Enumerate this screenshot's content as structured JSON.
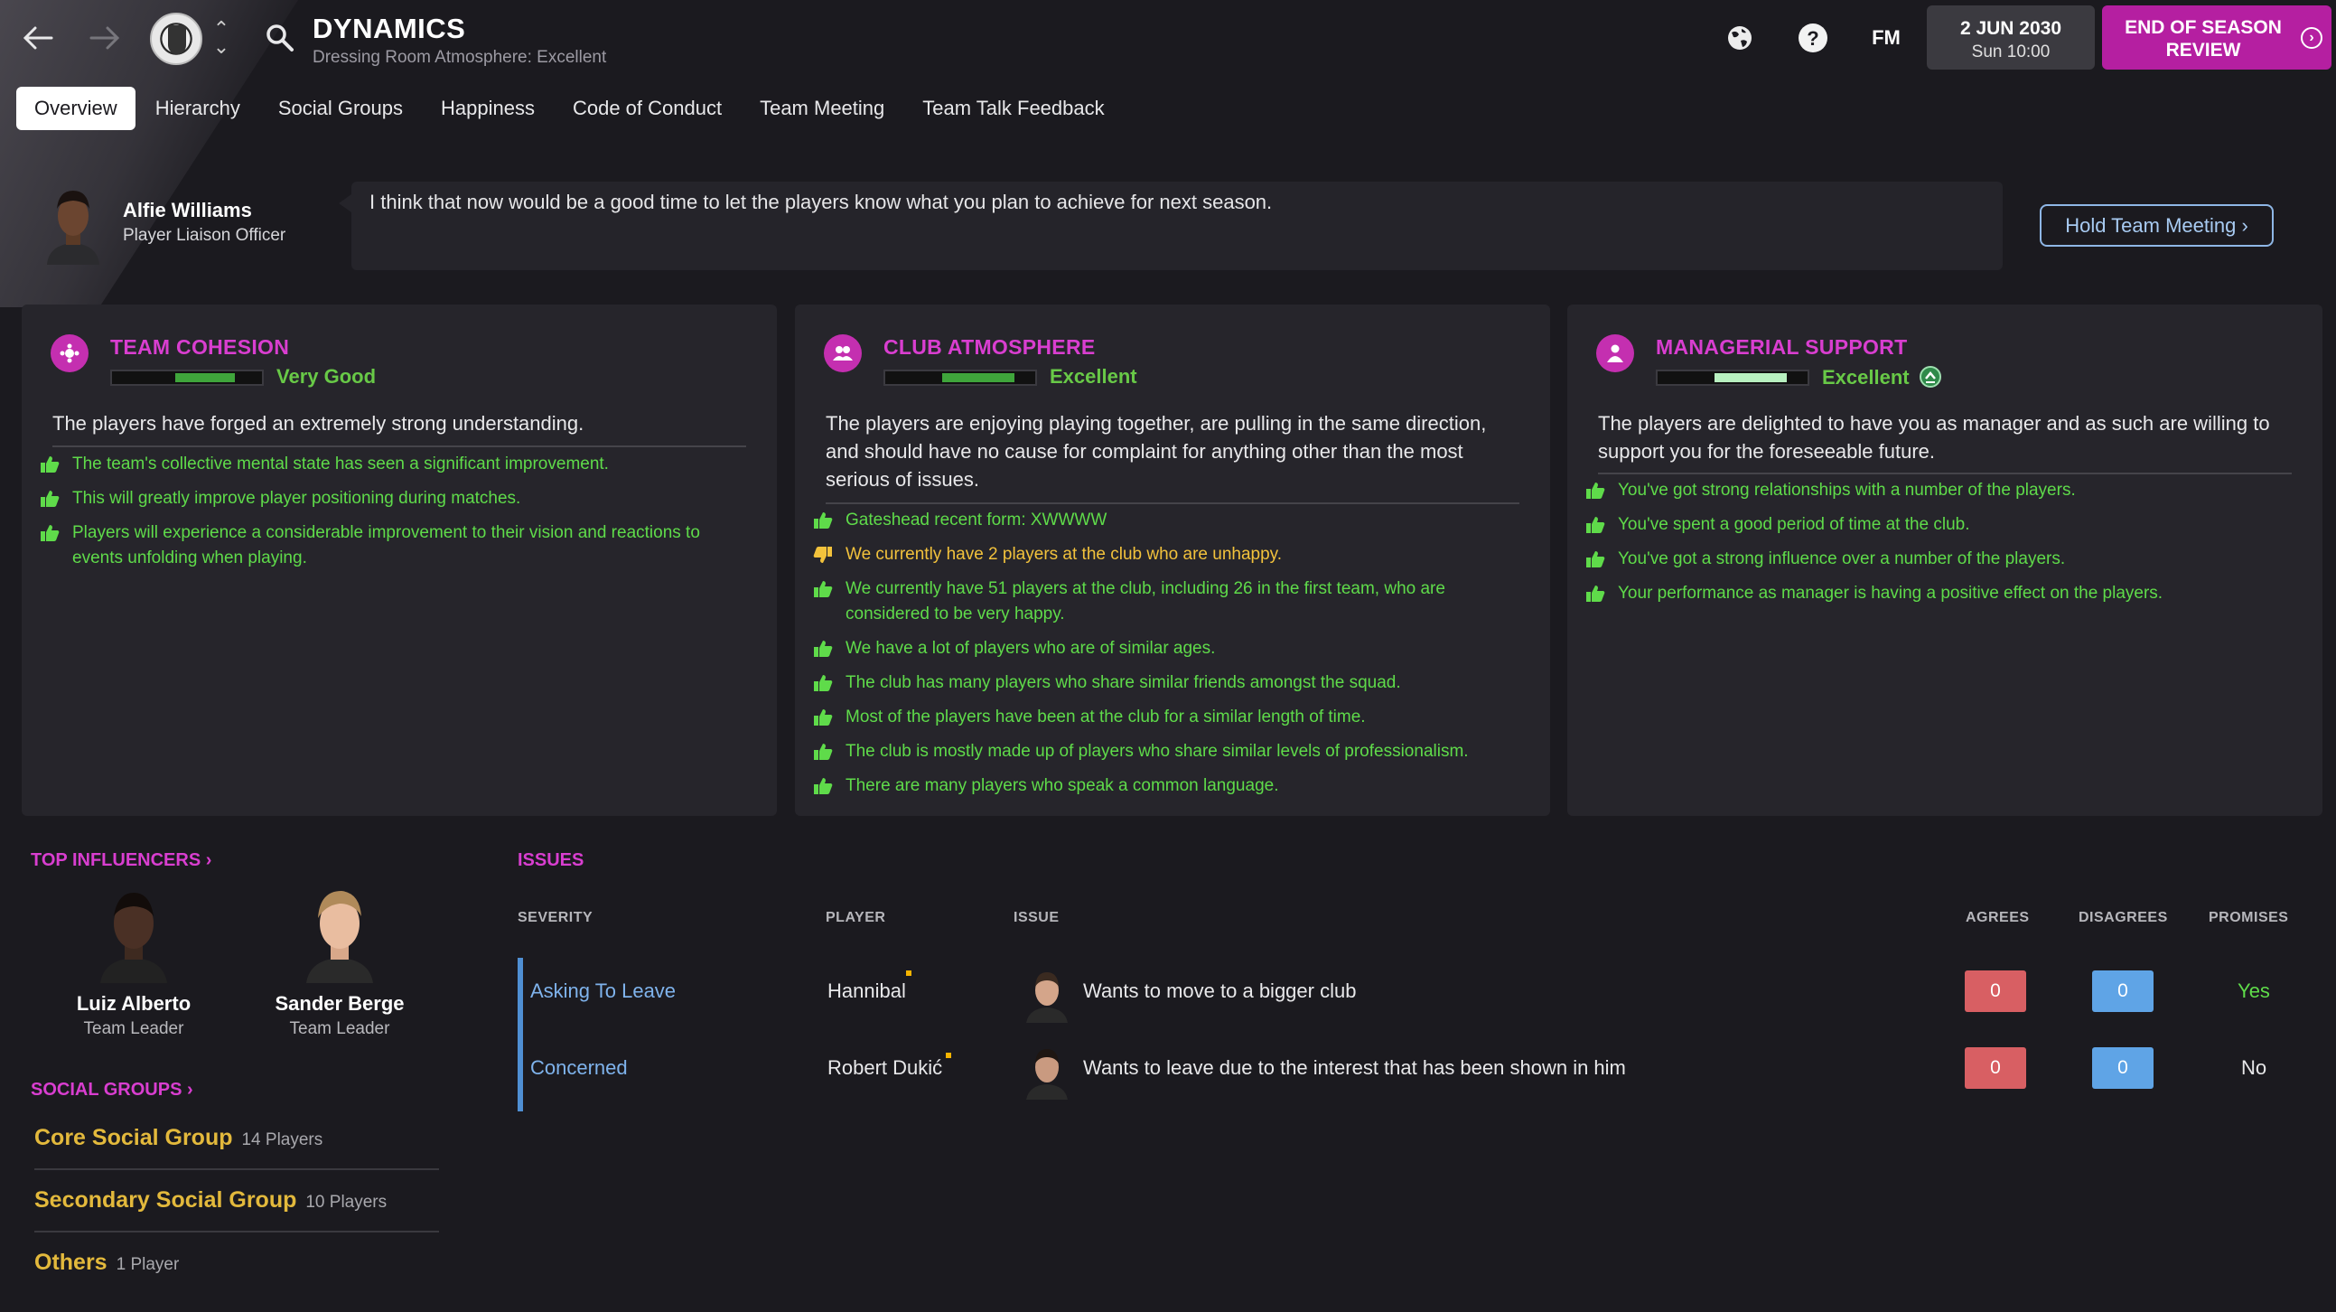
{
  "header": {
    "title": "DYNAMICS",
    "subtitle": "Dressing Room Atmosphere: Excellent",
    "date": "2 JUN 2030",
    "time": "Sun 10:00",
    "fm_label": "FM",
    "end_of_season_line1": "END OF SEASON",
    "end_of_season_line2": "REVIEW"
  },
  "tabs": [
    "Overview",
    "Hierarchy",
    "Social Groups",
    "Happiness",
    "Code of Conduct",
    "Team Meeting",
    "Team Talk Feedback"
  ],
  "liaison": {
    "name": "Alfie Williams",
    "role": "Player Liaison Officer",
    "message": "I think that now would be a good time to let the players know what you plan to achieve for next season.",
    "button": "Hold Team Meeting"
  },
  "panels": {
    "cohesion": {
      "title": "TEAM COHESION",
      "rating": "Very Good",
      "level": 0.5,
      "description": "The players have forged an extremely strong understanding.",
      "bullets": [
        "The team's collective mental state has seen a significant improvement.",
        "This will greatly improve player positioning during matches.",
        "Players will experience a considerable improvement to their vision and reactions to events unfolding when playing."
      ]
    },
    "atmosphere": {
      "title": "CLUB ATMOSPHERE",
      "rating": "Excellent",
      "level": 0.6,
      "description": "The players are enjoying playing together, are pulling in the same direction, and should have no cause for complaint for anything other than the most serious of issues.",
      "bullets": [
        "Gateshead recent form: XWWWW",
        "We currently have 2 players at the club who are unhappy.",
        "We currently have 51 players at the club, including 26 in the first team, who are considered to be very happy.",
        "We have a lot of players who are of similar ages.",
        "The club has many players who share similar friends amongst the squad.",
        "Most of the players have been at the club for a similar length of time.",
        "The club is mostly made up of players who share similar levels of professionalism.",
        "There are many players who speak a common language."
      ]
    },
    "support": {
      "title": "MANAGERIAL SUPPORT",
      "rating": "Excellent",
      "level": 0.6,
      "description": "The players are delighted to have you as manager and as such are willing to support you for the foreseeable future.",
      "bullets": [
        "You've got strong relationships with a number of the players.",
        "You've spent a good period of time at the club.",
        "You've got a strong influence over a number of the players.",
        "Your performance as manager is having a positive effect on the players."
      ]
    }
  },
  "influencers": {
    "title": "TOP INFLUENCERS",
    "people": [
      {
        "name": "Luiz Alberto",
        "role": "Team Leader"
      },
      {
        "name": "Sander Berge",
        "role": "Team Leader"
      }
    ]
  },
  "social_groups": {
    "title": "SOCIAL GROUPS",
    "groups": [
      {
        "name": "Core Social Group",
        "count": "14 Players"
      },
      {
        "name": "Secondary Social Group",
        "count": "10 Players"
      },
      {
        "name": "Others",
        "count": "1 Player"
      }
    ]
  },
  "issues": {
    "title": "ISSUES",
    "columns": {
      "severity": "SEVERITY",
      "player": "PLAYER",
      "issue": "ISSUE",
      "agrees": "AGREES",
      "disagrees": "DISAGREES",
      "promises": "PROMISES"
    },
    "rows": [
      {
        "severity": "Asking To Leave",
        "player": "Hannibal",
        "issue": "Wants to move to a bigger club",
        "agrees": "0",
        "disagrees": "0",
        "promises": "Yes"
      },
      {
        "severity": "Concerned",
        "player": "Robert Dukić",
        "issue": "Wants to leave due to the interest that has been shown in him",
        "agrees": "0",
        "disagrees": "0",
        "promises": "No"
      }
    ]
  },
  "colors": {
    "accent": "#b51fa1",
    "heading": "#d93ed0",
    "positive": "#5fdb4a",
    "warning": "#f2c23c",
    "group": "#e3b93c"
  }
}
